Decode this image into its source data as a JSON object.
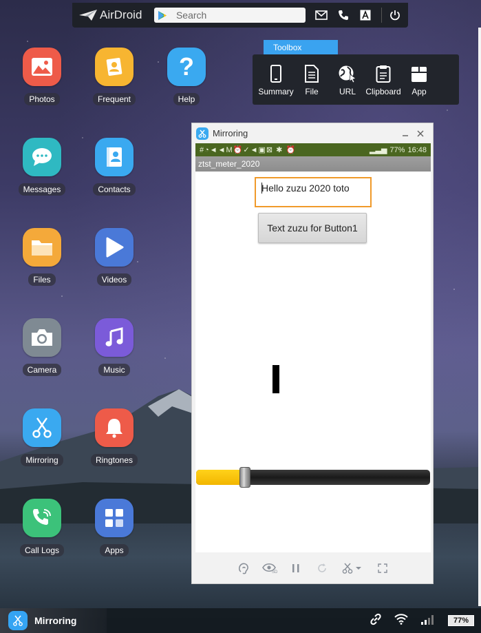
{
  "topbar": {
    "brand": "AirDroid",
    "search_placeholder": "Search",
    "icons": [
      "mail-icon",
      "phone-icon",
      "font-a-icon",
      "power-icon"
    ]
  },
  "desktop": {
    "apps": [
      {
        "label": "Photos",
        "icon": "photos-icon",
        "color": "#ee5b49"
      },
      {
        "label": "Frequent",
        "icon": "frequent-contacts-icon",
        "color": "#f7b531"
      },
      {
        "label": "Help",
        "icon": "help-icon",
        "color": "#3aa9f0"
      },
      {
        "label": "Messages",
        "icon": "messages-icon",
        "color": "#2fb9c2"
      },
      {
        "label": "Contacts",
        "icon": "contacts-icon",
        "color": "#3aa9f0"
      },
      {
        "label": "Files",
        "icon": "folder-icon",
        "color": "#f4a93a"
      },
      {
        "label": "Videos",
        "icon": "play-icon",
        "color": "#4a79d8"
      },
      {
        "label": "Camera",
        "icon": "camera-icon",
        "color": "#7f8a93"
      },
      {
        "label": "Music",
        "icon": "music-icon",
        "color": "#7b5bd9"
      },
      {
        "label": "Mirroring",
        "icon": "scissors-icon",
        "color": "#3aa9f0"
      },
      {
        "label": "Ringtones",
        "icon": "bell-icon",
        "color": "#ee5b49"
      },
      {
        "label": "Call Logs",
        "icon": "call-log-icon",
        "color": "#3cc27a"
      },
      {
        "label": "Apps",
        "icon": "apps-grid-icon",
        "color": "#4a79d8"
      }
    ]
  },
  "toolbox": {
    "title": "Toolbox",
    "tools": [
      {
        "label": "Summary",
        "icon": "phone-summary-icon"
      },
      {
        "label": "File",
        "icon": "file-icon"
      },
      {
        "label": "URL",
        "icon": "globe-icon"
      },
      {
        "label": "Clipboard",
        "icon": "clipboard-icon"
      },
      {
        "label": "App",
        "icon": "app-box-icon"
      }
    ]
  },
  "mirroring_window": {
    "title": "Mirroring",
    "phone": {
      "status_battery": "77%",
      "status_time": "16:48",
      "app_title": "ztst_meter_2020",
      "textbox_value": "Hello zuzu 2020 toto",
      "button_label": "Text zuzu for Button1",
      "slider_fraction": 0.21
    },
    "controls": [
      "ear-icon",
      "eye-sd-icon",
      "pause-icon",
      "rotate-icon",
      "scissors-dropdown-icon",
      "fullscreen-icon"
    ]
  },
  "taskbar": {
    "app_label": "Mirroring",
    "battery": "77%"
  },
  "colors": {
    "accent": "#3aa3f0",
    "slider_fill": "#f2b600",
    "statusbar": "#4a6620",
    "textbox_border": "#f09a2a"
  }
}
